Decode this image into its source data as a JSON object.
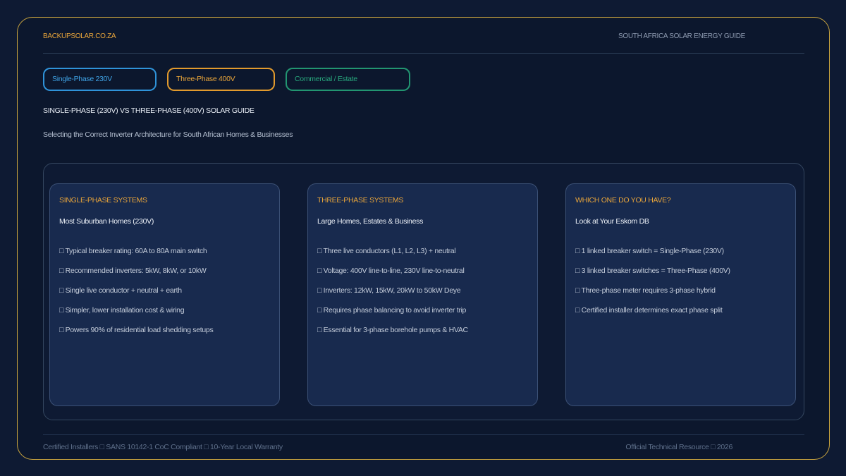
{
  "header": {
    "brand": "BACKUPSOLAR.CO.ZA",
    "guide": "SOUTH AFRICA SOLAR ENERGY GUIDE"
  },
  "pills": [
    {
      "label": "Single-Phase 230V",
      "color": "#2f93d9"
    },
    {
      "label": "Three-Phase 400V",
      "color": "#e29a2d"
    },
    {
      "label": "Commercial / Estate",
      "color": "#229571"
    }
  ],
  "headline": "SINGLE-PHASE (230V) VS THREE-PHASE (400V) SOLAR GUIDE",
  "subline": "Selecting the Correct Inverter Architecture for South African Homes & Businesses",
  "cards": [
    {
      "title": "SINGLE-PHASE SYSTEMS",
      "subtitle": "Most Suburban Homes (230V)",
      "items": [
        "□ Typical breaker rating: 60A to 80A main switch",
        "□ Recommended inverters: 5kW, 8kW, or 10kW",
        "□ Single live conductor + neutral + earth",
        "□ Simpler, lower installation cost & wiring",
        "□ Powers 90% of residential load shedding setups"
      ]
    },
    {
      "title": "THREE-PHASE SYSTEMS",
      "subtitle": "Large Homes, Estates & Business",
      "items": [
        "□ Three live conductors (L1, L2, L3) + neutral",
        "□ Voltage: 400V line-to-line, 230V line-to-neutral",
        "□ Inverters: 12kW, 15kW, 20kW to 50kW Deye",
        "□ Requires phase balancing to avoid inverter trip",
        "□ Essential for 3-phase borehole pumps & HVAC"
      ]
    },
    {
      "title": "WHICH ONE DO YOU HAVE?",
      "subtitle": "Look at Your Eskom DB",
      "items": [
        "□ 1 linked breaker switch = Single-Phase (230V)",
        "□ 3 linked breaker switches = Three-Phase (400V)",
        "□ Three-phase meter requires 3-phase hybrid",
        "□ Certified installer determines exact phase split"
      ]
    }
  ],
  "footer": {
    "left": "Certified Installers □ SANS 10142-1 CoC Compliant □ 10-Year Local Warranty",
    "right": "Official Technical Resource □ 2026"
  }
}
